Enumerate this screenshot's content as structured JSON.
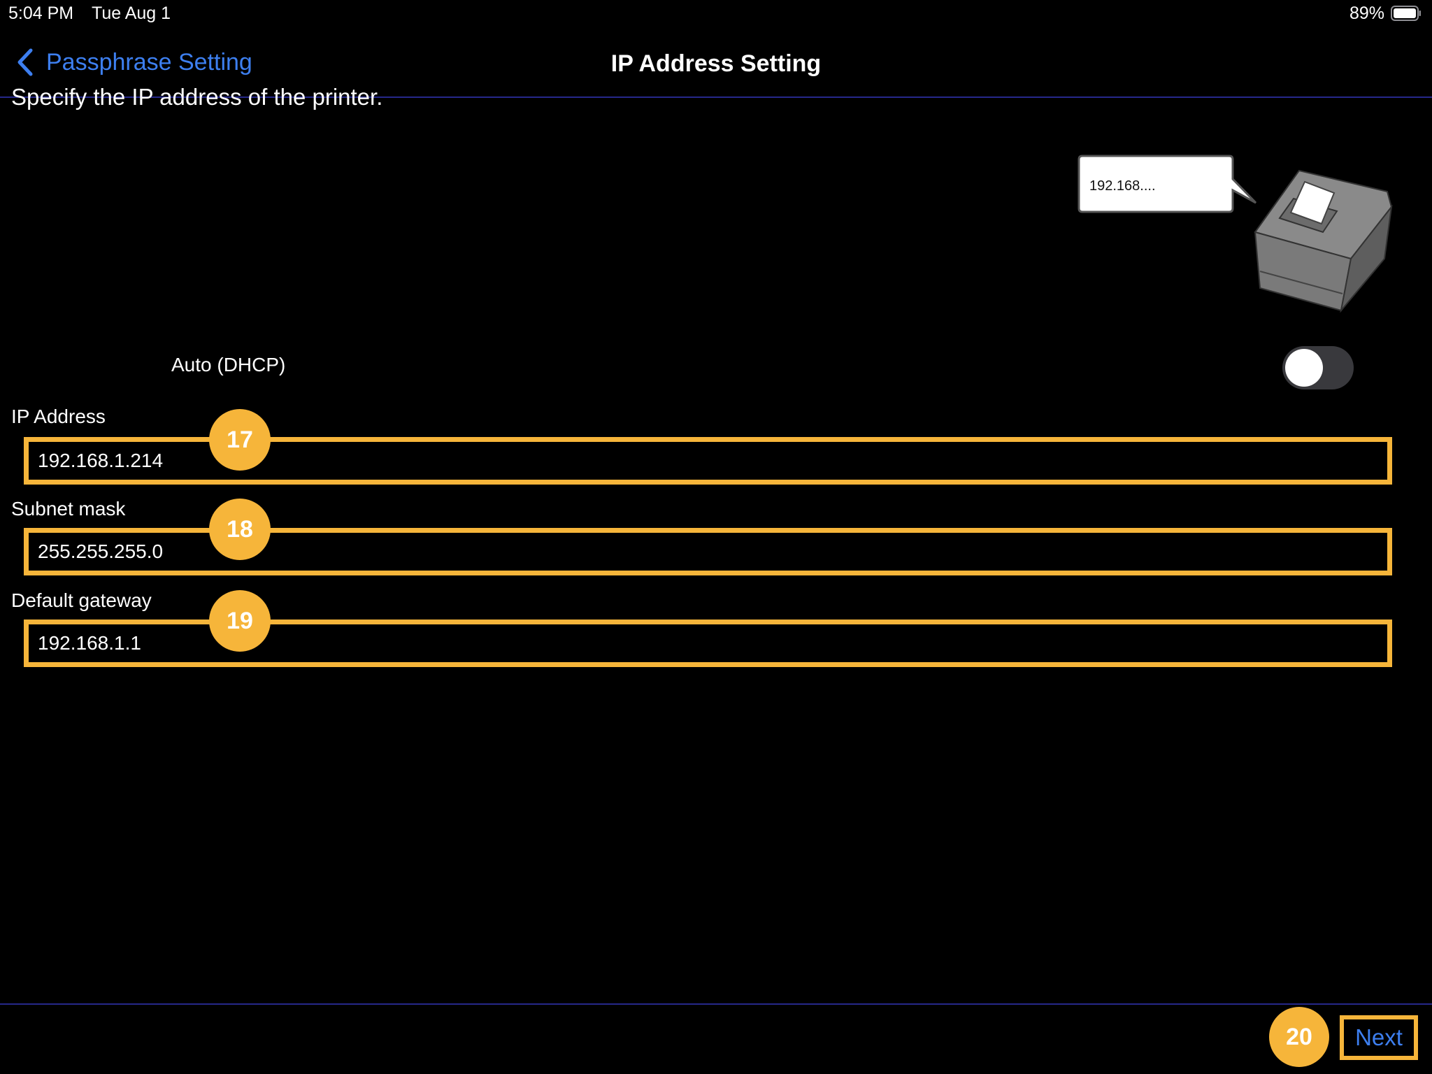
{
  "status_bar": {
    "time": "5:04 PM",
    "date": "Tue Aug 1",
    "battery_percent": "89%",
    "battery_level": 0.89
  },
  "nav": {
    "back_label": "Passphrase Setting",
    "title": "IP Address Setting",
    "accent_color": "#3d7ff0"
  },
  "instruction": "Specify the IP address of the printer.",
  "illustration": {
    "bubble_text": "192.168...."
  },
  "dhcp": {
    "label": "Auto (DHCP)",
    "enabled": false
  },
  "fields": [
    {
      "label": "IP Address",
      "value": "192.168.1.214",
      "badge": "17"
    },
    {
      "label": "Subnet mask",
      "value": "255.255.255.0",
      "badge": "18"
    },
    {
      "label": "Default gateway",
      "value": "192.168.1.1",
      "badge": "19"
    }
  ],
  "toolbar": {
    "next_badge": "20",
    "next_label": "Next"
  },
  "highlight_color": "#f6b53a"
}
